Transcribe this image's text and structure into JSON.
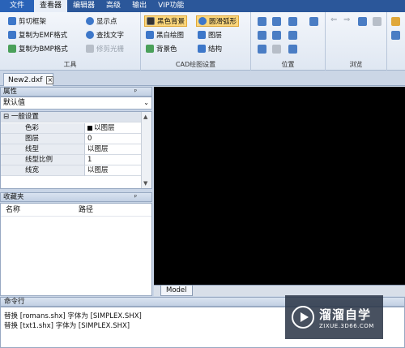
{
  "menu": {
    "items": [
      "文件",
      "查看器",
      "编辑器",
      "高级",
      "输出",
      "VIP功能"
    ]
  },
  "ribbon": {
    "tools": {
      "label": "工具",
      "buttons": [
        "剪切框架",
        "显示点",
        "复制为EMF格式",
        "查找文字",
        "复制为BMP格式",
        "修剪光栅"
      ]
    },
    "cad": {
      "label": "CAD绘图设置",
      "buttons": [
        "黑色背景",
        "圆滑弧形",
        "黑白绘图",
        "图层",
        "背景色",
        "结构"
      ]
    },
    "position": {
      "label": "位置"
    },
    "browse": {
      "label": "浏览"
    }
  },
  "doc": {
    "tab": "New2.dxf"
  },
  "properties": {
    "title": "属性",
    "pin": "ᵖ",
    "selected": "默认值",
    "category": "⊟ 一般设置",
    "rows": [
      {
        "key": "色彩",
        "value": "以图层"
      },
      {
        "key": "图层",
        "value": "0"
      },
      {
        "key": "线型",
        "value": "以图层"
      },
      {
        "key": "线型比例",
        "value": "1"
      },
      {
        "key": "线宽",
        "value": "以图层"
      }
    ]
  },
  "favorites": {
    "title": "收藏夹",
    "col_name": "名称",
    "col_path": "路径"
  },
  "model_tab": "Model",
  "command": {
    "title": "命令行",
    "lines": [
      "替换 [romans.shx] 字体为 [SIMPLEX.SHX]",
      "替换 [txt1.shx] 字体为 [SIMPLEX.SHX]"
    ]
  },
  "watermark": {
    "brand": "溜溜自学",
    "site": "ZIXUE.3D66.COM"
  }
}
